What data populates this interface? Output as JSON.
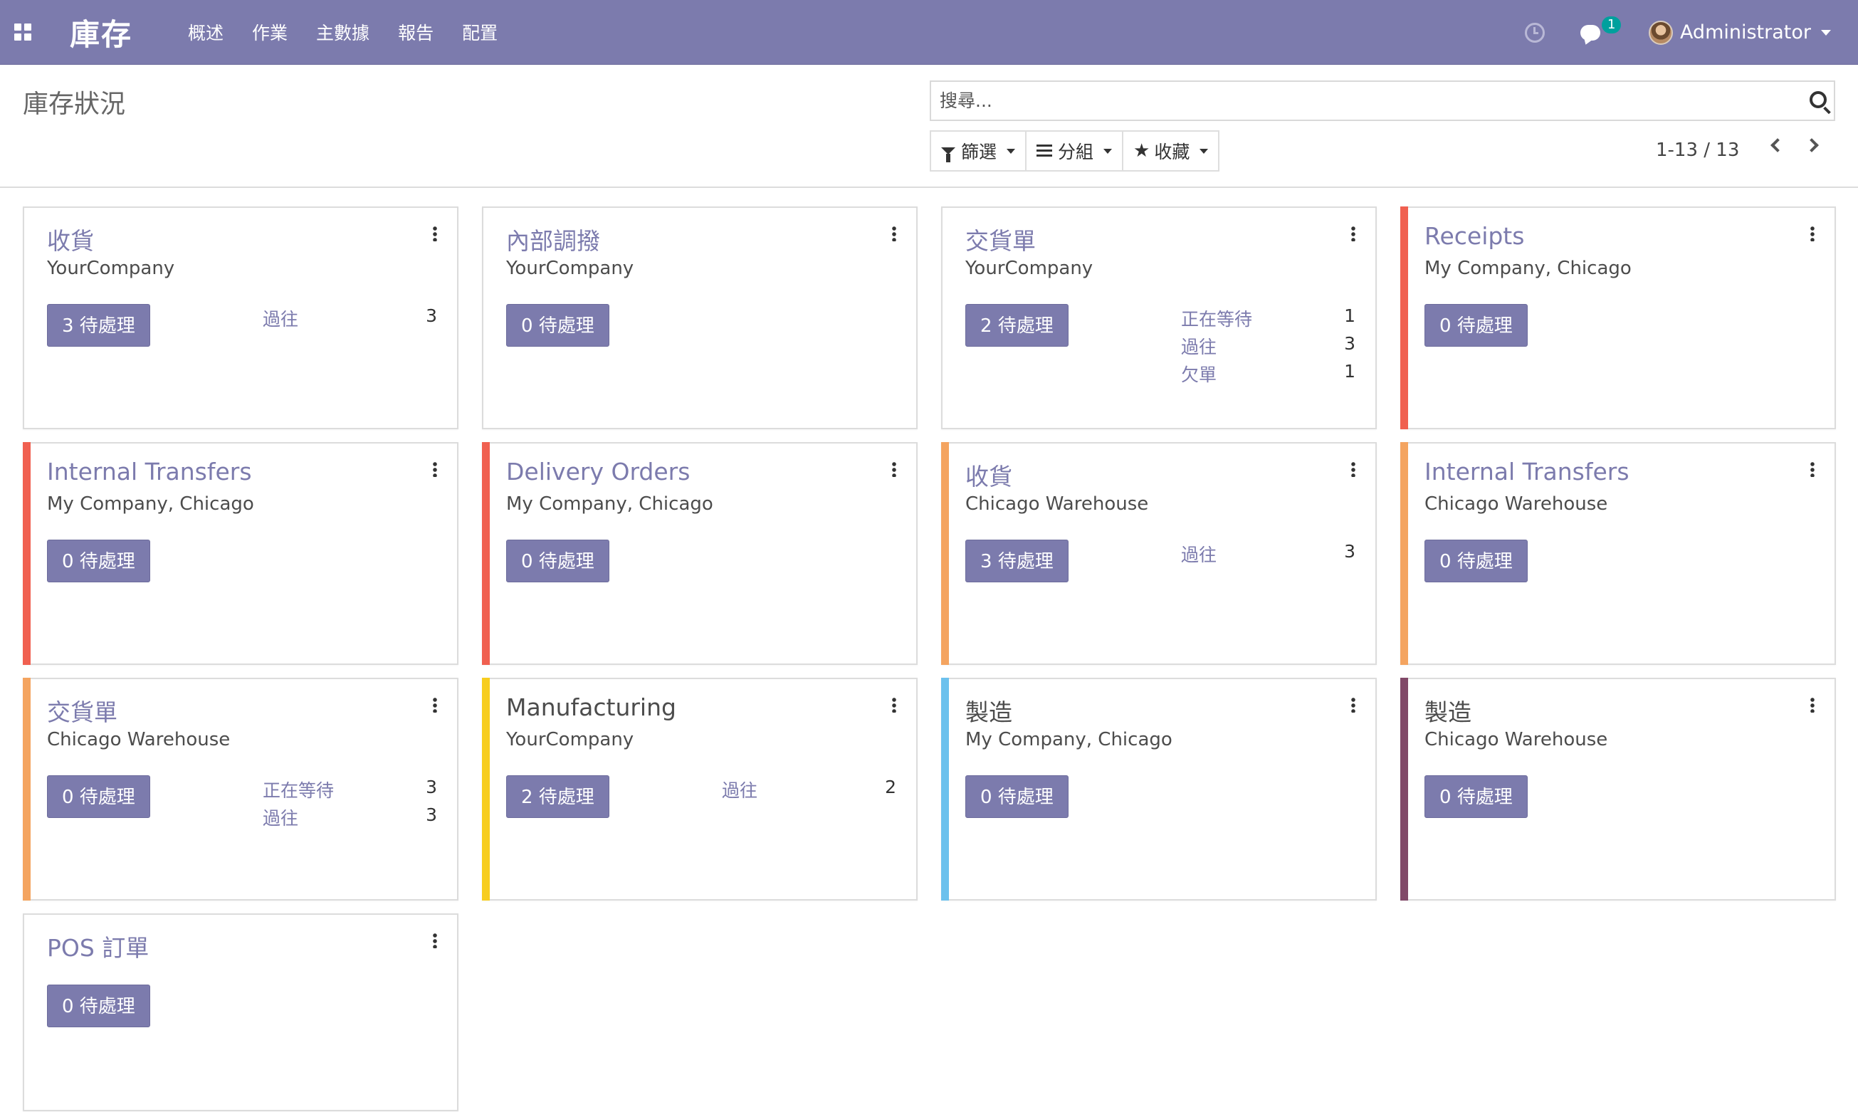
{
  "navbar": {
    "app_title": "庫存",
    "menu": [
      "概述",
      "作業",
      "主數據",
      "報告",
      "配置"
    ],
    "messages_count": "1",
    "user_name": "Administrator",
    "bg_color": "#7c7bad"
  },
  "control": {
    "breadcrumb": "庫存狀況",
    "search_placeholder": "搜尋...",
    "filter_label": "篩選",
    "group_label": "分組",
    "favorites_label": "收藏",
    "pager": "1-13 / 13"
  },
  "cards": [
    {
      "title": "收貨",
      "subtitle": "YourCompany",
      "todo": "3 待處理",
      "stripe": "",
      "stats": [
        {
          "label": "過往",
          "value": "3"
        }
      ]
    },
    {
      "title": "內部調撥",
      "subtitle": "YourCompany",
      "todo": "0 待處理",
      "stripe": "",
      "stats": []
    },
    {
      "title": "交貨單",
      "subtitle": "YourCompany",
      "todo": "2 待處理",
      "stripe": "",
      "stats": [
        {
          "label": "正在等待",
          "value": "1"
        },
        {
          "label": "過往",
          "value": "3"
        },
        {
          "label": "欠單",
          "value": "1"
        }
      ]
    },
    {
      "title": "Receipts",
      "subtitle": "My Company, Chicago",
      "todo": "0 待處理",
      "stripe": "#f06050",
      "stats": []
    },
    {
      "title": "Internal Transfers",
      "subtitle": "My Company, Chicago",
      "todo": "0 待處理",
      "stripe": "#f06050",
      "stats": []
    },
    {
      "title": "Delivery Orders",
      "subtitle": "My Company, Chicago",
      "todo": "0 待處理",
      "stripe": "#f06050",
      "stats": []
    },
    {
      "title": "收貨",
      "subtitle": "Chicago Warehouse",
      "todo": "3 待處理",
      "stripe": "#f4a460",
      "stats": [
        {
          "label": "過往",
          "value": "3"
        }
      ]
    },
    {
      "title": "Internal Transfers",
      "subtitle": "Chicago Warehouse",
      "todo": "0 待處理",
      "stripe": "#f4a460",
      "stats": []
    },
    {
      "title": "交貨單",
      "subtitle": "Chicago Warehouse",
      "todo": "0 待處理",
      "stripe": "#f4a460",
      "stats": [
        {
          "label": "正在等待",
          "value": "3"
        },
        {
          "label": "過往",
          "value": "3"
        }
      ]
    },
    {
      "title": "Manufacturing",
      "subtitle": "YourCompany",
      "todo": "2 待處理",
      "stripe": "#f7cd1f",
      "dark": true,
      "stats": [
        {
          "label": "過往",
          "value": "2"
        }
      ]
    },
    {
      "title": "製造",
      "subtitle": "My Company, Chicago",
      "todo": "0 待處理",
      "stripe": "#6cc1ed",
      "dark": true,
      "stats": []
    },
    {
      "title": "製造",
      "subtitle": "Chicago Warehouse",
      "todo": "0 待處理",
      "stripe": "#814968",
      "dark": true,
      "stats": []
    },
    {
      "title": "POS 訂單",
      "subtitle": "",
      "todo": "0 待處理",
      "stripe": "",
      "stats": []
    }
  ]
}
